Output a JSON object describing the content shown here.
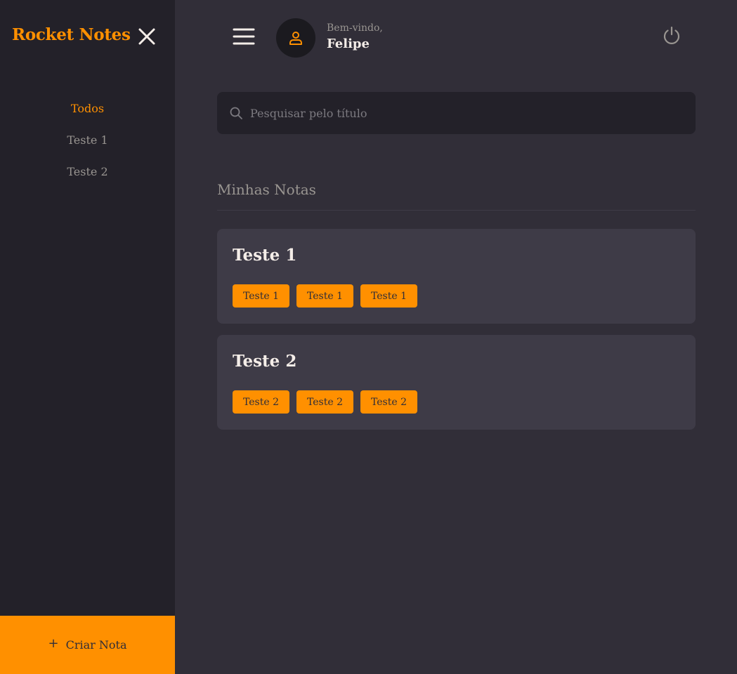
{
  "sidebar": {
    "brand": "Rocket Notes",
    "nav": [
      "Todos",
      "Teste 1",
      "Teste 2"
    ],
    "active_index": 0,
    "create_label": "Criar Nota",
    "create_icon": "+"
  },
  "header": {
    "welcome": "Bem-vindo,",
    "username": "Felipe"
  },
  "search": {
    "placeholder": "Pesquisar pelo título",
    "value": ""
  },
  "section": {
    "title": "Minhas Notas"
  },
  "notes": [
    {
      "title": "Teste 1",
      "tags": [
        "Teste 1",
        "Teste 1",
        "Teste 1"
      ]
    },
    {
      "title": "Teste 2",
      "tags": [
        "Teste 2",
        "Teste 2",
        "Teste 2"
      ]
    }
  ],
  "colors": {
    "accent": "#ff9000",
    "background": "#312e38",
    "sidebar": "#232129",
    "card": "#3e3b47",
    "text": "#f4ede8",
    "muted": "#999591"
  },
  "icons": [
    "close-icon",
    "menu-icon",
    "user-icon",
    "power-icon",
    "search-icon",
    "plus-icon"
  ]
}
